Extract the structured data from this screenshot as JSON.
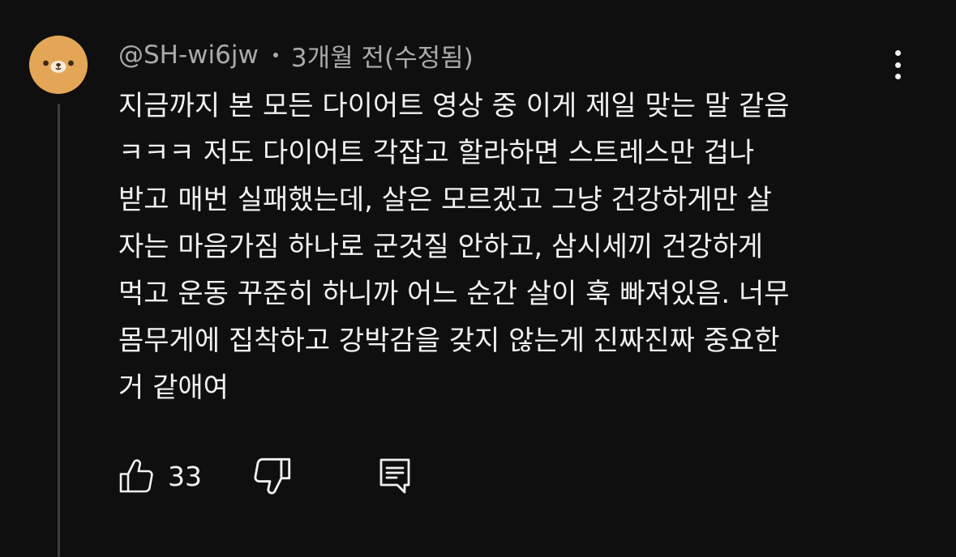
{
  "comment": {
    "author": "@SH-wi6jw",
    "timestamp": "3개월 전(수정됨)",
    "avatar_icon": "bear-face-icon",
    "avatar_color": "#e3a657",
    "text_lines": [
      "지금까지 본 모든 다이어트 영상 중 이게 제일 맞는 말 같음",
      "ㅋㅋㅋ 저도 다이어트 각잡고 할라하면 스트레스만 겁나",
      "받고 매번 실패했는데, 살은 모르겠고 그냥 건강하게만 살",
      "자는 마음가짐 하나로 군것질 안하고, 삼시세끼 건강하게",
      "먹고 운동 꾸준히 하니까 어느 순간 살이 훅 빠져있음. 너무",
      "몸무게에 집착하고 강박감을 갖지 않는게 진짜진짜 중요한",
      "거 같애여"
    ],
    "like_count": "33"
  },
  "icons": {
    "more": "more-vert-icon",
    "like": "thumbs-up-icon",
    "dislike": "thumbs-down-icon",
    "reply": "comment-reply-icon"
  },
  "colors": {
    "background": "#0f0f0f",
    "primary_text": "#f1f1f1",
    "secondary_text": "#aaaaaa",
    "thread_line": "#3f3f3f"
  }
}
